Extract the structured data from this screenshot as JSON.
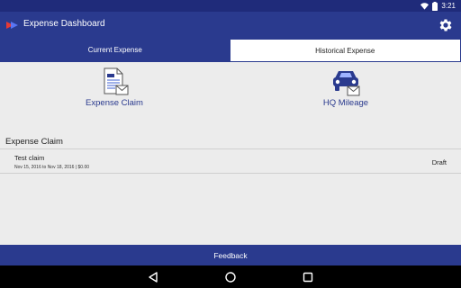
{
  "status_bar": {
    "time": "3:21"
  },
  "app_bar": {
    "title": "Expense Dashboard"
  },
  "tabs": [
    {
      "label": "Current Expense",
      "active": true
    },
    {
      "label": "Historical Expense",
      "active": false
    }
  ],
  "tiles": [
    {
      "label": "Expense Claim",
      "icon": "document-mail-icon"
    },
    {
      "label": "HQ Mileage",
      "icon": "car-mail-icon"
    }
  ],
  "section": {
    "title": "Expense Claim"
  },
  "claims": [
    {
      "name": "Test claim",
      "meta": "Nov 15, 2016 to Nov 18, 2016 | $0.00",
      "status": "Draft"
    }
  ],
  "feedback": {
    "label": "Feedback"
  },
  "colors": {
    "primary": "#2a3a8e",
    "status_bar": "#1f2b7a",
    "background": "#ececec"
  }
}
